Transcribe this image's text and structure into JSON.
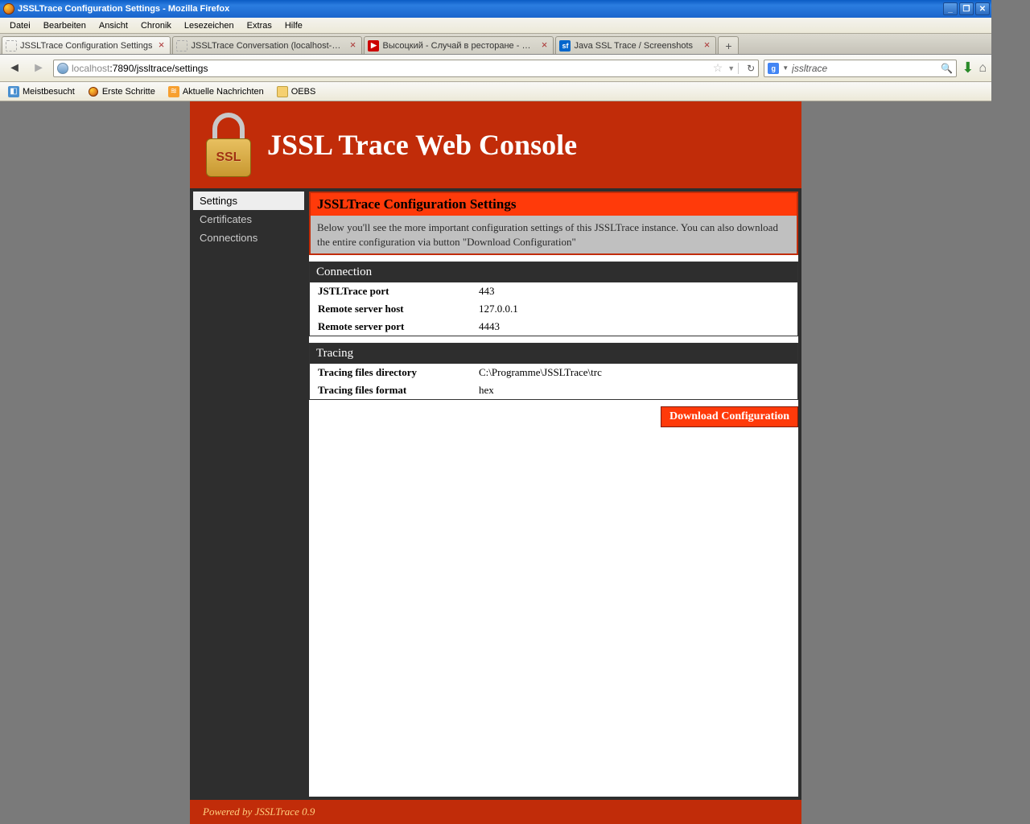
{
  "window": {
    "title": "JSSLTrace Configuration Settings - Mozilla Firefox"
  },
  "menubar": [
    "Datei",
    "Bearbeiten",
    "Ansicht",
    "Chronik",
    "Lesezeichen",
    "Extras",
    "Hilfe"
  ],
  "tabs": [
    {
      "label": "JSSLTrace Configuration Settings",
      "active": true
    },
    {
      "label": "JSSLTrace Conversation (localhost->127...",
      "active": false
    },
    {
      "label": "Высоцкий - Случай в ресторане - YouT...",
      "active": false
    },
    {
      "label": "Java SSL Trace / Screenshots",
      "active": false
    }
  ],
  "url": {
    "host": "localhost",
    "rest": ":7890/jssltrace/settings"
  },
  "search": {
    "value": "jssltrace"
  },
  "bookmarks": [
    {
      "label": "Meistbesucht",
      "icon": "mv"
    },
    {
      "label": "Erste Schritte",
      "icon": "ff"
    },
    {
      "label": "Aktuelle Nachrichten",
      "icon": "rss"
    },
    {
      "label": "OEBS",
      "icon": "folder"
    }
  ],
  "page": {
    "title": "JSSL Trace Web Console",
    "lock_label": "SSL",
    "sidebar": [
      {
        "label": "Settings",
        "active": true
      },
      {
        "label": "Certificates",
        "active": false
      },
      {
        "label": "Connections",
        "active": false
      }
    ],
    "info": {
      "heading": "JSSLTrace Configuration Settings",
      "desc": "Below you'll see the more important configuration settings of this JSSLTrace instance. You can also download the entire configuration via button \"Download Configuration\""
    },
    "sections": [
      {
        "heading": "Connection",
        "rows": [
          {
            "k": "JSTLTrace port",
            "v": "443"
          },
          {
            "k": "Remote server host",
            "v": "127.0.0.1"
          },
          {
            "k": "Remote server port",
            "v": "4443"
          }
        ]
      },
      {
        "heading": "Tracing",
        "rows": [
          {
            "k": "Tracing files directory",
            "v": "C:\\Programme\\JSSLTrace\\trc"
          },
          {
            "k": "Tracing files format",
            "v": "hex"
          }
        ]
      }
    ],
    "download_label": "Download Configuration",
    "footer": "Powered by JSSLTrace 0.9"
  }
}
